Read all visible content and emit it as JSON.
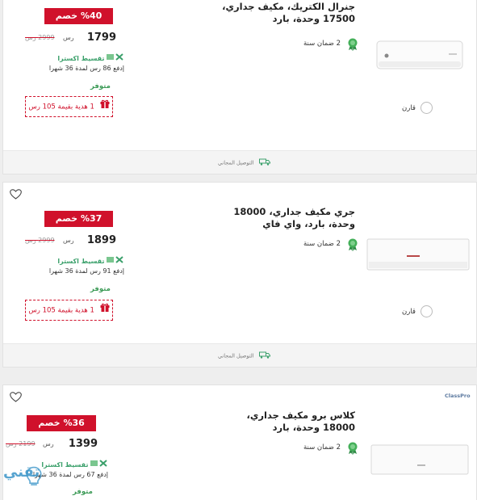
{
  "products": [
    {
      "title": "جنرال الكتريك، مكيف جداري، 17500 وحدة، بارد",
      "discount": "%40 خصم",
      "price": "1799",
      "currency": "رس",
      "old_price": "2999 رس",
      "installment_label": "تقسيط اكسترا",
      "installment_text": "إدفع 86 رس لمدة 36 شهرا",
      "stock": "متوفر",
      "gift": "1 هدية بقيمة 105 رس",
      "warranty": "2 ضمان سنة",
      "compare": "قارن",
      "delivery": "التوصيل المجاني"
    },
    {
      "title": "جري مكيف جداري، 18000 وحدة، بارد، واي فاي",
      "discount": "%37 خصم",
      "price": "1899",
      "currency": "رس",
      "old_price": "2999 رس",
      "installment_label": "تقسيط اكسترا",
      "installment_text": "إدفع 91 رس لمدة 36 شهرا",
      "stock": "متوفر",
      "gift": "1 هدية بقيمة 105 رس",
      "warranty": "2 ضمان سنة",
      "compare": "قارن",
      "delivery": "التوصيل المجاني"
    },
    {
      "title": "كلاس برو مكيف جداري، 18000 وحدة، بارد",
      "discount": "%36 خصم",
      "price": "1399",
      "currency": "رس",
      "old_price": "2199 رس",
      "installment_label": "تقسيط اكسترا",
      "installment_text": "إدفع 67 رس لمدة 36 شهرا",
      "stock": "متوفر",
      "warranty": "2 ضمان سنة",
      "brand": "ClassPro"
    }
  ],
  "watermark": "تقني",
  "colors": {
    "accent": "#d0112b",
    "tasheel": "#3ba06b",
    "stock": "#3b9a56",
    "medal": "#45b05a"
  },
  "icons": [
    "heart-icon",
    "gift-icon",
    "medal-icon",
    "truck-icon",
    "installment-icon"
  ]
}
